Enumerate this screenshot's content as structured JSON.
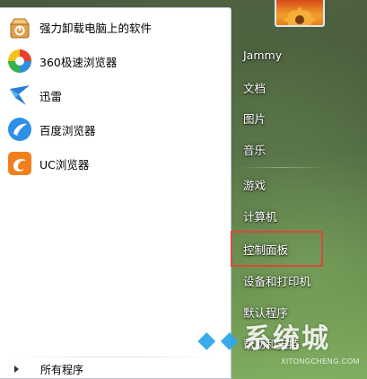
{
  "programs": [
    {
      "label": "强力卸载电脑上的软件",
      "icon": "uninstall-box-icon"
    },
    {
      "label": "360极速浏览器",
      "icon": "360-browser-icon"
    },
    {
      "label": "迅雷",
      "icon": "xunlei-bird-icon"
    },
    {
      "label": "百度浏览器",
      "icon": "baidu-browser-icon"
    },
    {
      "label": "UC浏览器",
      "icon": "uc-squirrel-icon"
    }
  ],
  "all_programs": "所有程序",
  "right_items": [
    "Jammy",
    "文档",
    "图片",
    "音乐",
    "游戏",
    "计算机",
    "控制面板",
    "设备和打印机",
    "默认程序",
    "帮助和支持"
  ],
  "watermark": {
    "text": "系统城",
    "url": "XITONGCHENG.COM"
  },
  "colors": {
    "highlight_border": "#d9483a",
    "panel_bg": "#ffffff",
    "glass_text": "#ffffff"
  }
}
